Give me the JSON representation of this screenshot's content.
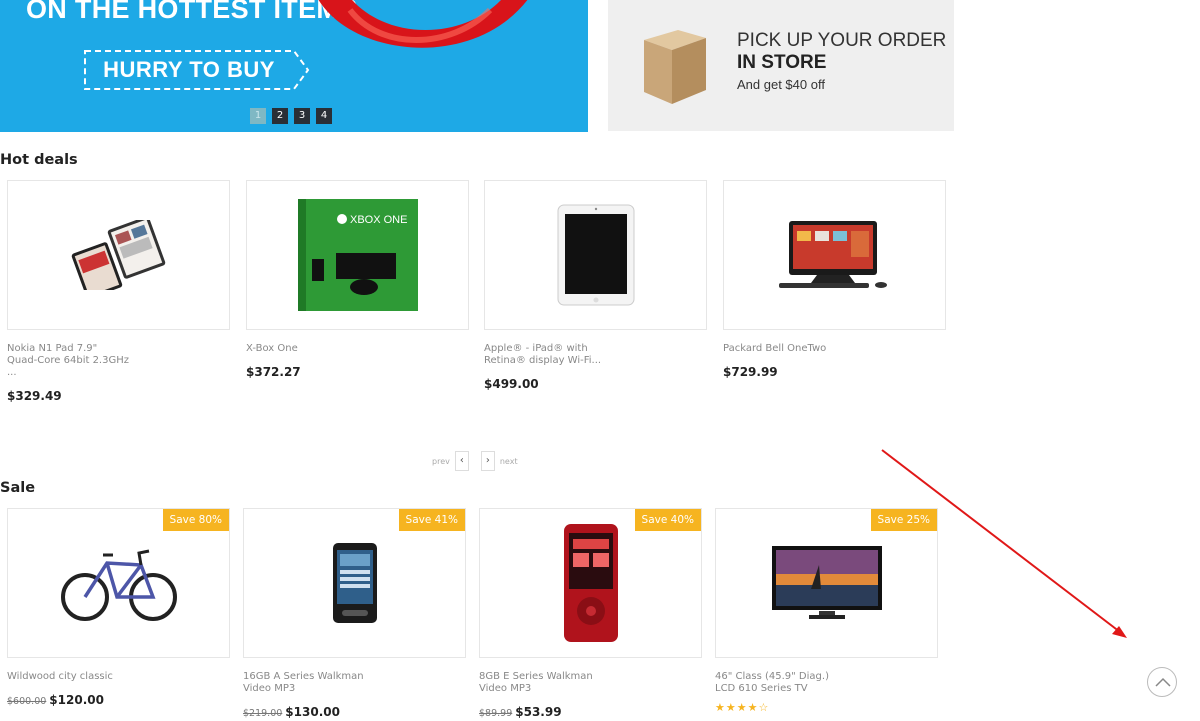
{
  "banner": {
    "headline": "ON THE HOTTEST ITEMS",
    "cta_label": "HURRY TO BUY",
    "slides": [
      "1",
      "2",
      "3",
      "4"
    ],
    "active_slide": "1"
  },
  "promo": {
    "line1": "PICK UP YOUR ORDER",
    "line2": "IN STORE",
    "line3": "And get $40 off"
  },
  "hot_deals": {
    "title": "Hot deals",
    "products": [
      {
        "name": "Nokia N1 Pad 7.9\"\nQuad-Core 64bit 2.3GHz\n...",
        "price": "$329.49",
        "icon": "tablet-image"
      },
      {
        "name": "X-Box One",
        "price": "$372.27",
        "icon": "xbox-box-image"
      },
      {
        "name": "Apple® - iPad® with\nRetina® display Wi-Fi...",
        "price": "$499.00",
        "icon": "ipad-image"
      },
      {
        "name": "Packard Bell OneTwo",
        "price": "$729.99",
        "icon": "all-in-one-pc-image"
      }
    ],
    "prev_label": "prev",
    "next_label": "next"
  },
  "sale": {
    "title": "Sale",
    "products": [
      {
        "name": "Wildwood city classic",
        "old_price": "$600.00",
        "price": "$120.00",
        "badge": "Save 80%",
        "icon": "bicycle-image"
      },
      {
        "name": "16GB A Series Walkman\nVideo MP3",
        "old_price": "$219.00",
        "price": "$130.00",
        "badge": "Save 41%",
        "icon": "walkman-black-image"
      },
      {
        "name": "8GB E Series Walkman\nVideo MP3",
        "old_price": "$89.99",
        "price": "$53.99",
        "badge": "Save 40%",
        "icon": "walkman-red-image"
      },
      {
        "name": "46\" Class (45.9\" Diag.)\nLCD 610 Series TV",
        "badge": "Save 25%",
        "rating": 4,
        "rating_max": 5,
        "icon": "tv-image"
      }
    ]
  },
  "colors": {
    "banner_bg": "#1ea9e6",
    "badge": "#f6b420",
    "annotation_arrow": "#e01818"
  },
  "icons": {
    "scroll_top": "chevron-up-icon",
    "prev": "chevron-left-icon",
    "next": "chevron-right-icon"
  }
}
